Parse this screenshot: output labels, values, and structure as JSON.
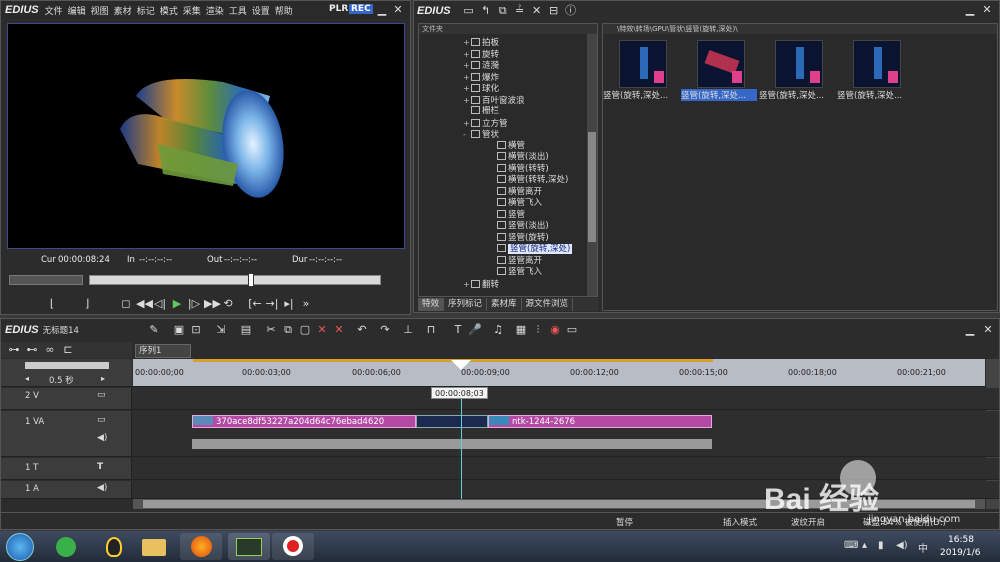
{
  "player": {
    "brand": "EDIUS",
    "menu": [
      "文件",
      "编辑",
      "视图",
      "素材",
      "标记",
      "模式",
      "采集",
      "渲染",
      "工具",
      "设置",
      "帮助"
    ],
    "plr": "PLR",
    "rec": "REC",
    "cur_label": "Cur",
    "cur_value": "00:00:08:24",
    "in_label": "In",
    "in_value": "--:--:--:--",
    "out_label": "Out",
    "out_value": "--:--:--:--",
    "dur_label": "Dur",
    "dur_value": "--:--:--:--"
  },
  "library": {
    "brand": "EDIUS",
    "folder_header": "文件夹",
    "path": "\\特效\\转场\\GPU\\管状\\竖管(旋转,深处)\\",
    "tree": [
      {
        "label": "拍板",
        "level": 1,
        "expand": "+"
      },
      {
        "label": "旋转",
        "level": 1,
        "expand": "+"
      },
      {
        "label": "涟漪",
        "level": 1,
        "expand": "+"
      },
      {
        "label": "爆炸",
        "level": 1,
        "expand": "+"
      },
      {
        "label": "球化",
        "level": 1,
        "expand": "+"
      },
      {
        "label": "百叶窗波浪",
        "level": 1,
        "expand": "+"
      },
      {
        "label": "栅栏",
        "level": 1,
        "expand": ""
      },
      {
        "label": "立方管",
        "level": 1,
        "expand": "+"
      },
      {
        "label": "管状",
        "level": 1,
        "expand": "-"
      },
      {
        "label": "横管",
        "level": 2,
        "expand": ""
      },
      {
        "label": "横管(淡出)",
        "level": 2,
        "expand": ""
      },
      {
        "label": "横管(转转)",
        "level": 2,
        "expand": ""
      },
      {
        "label": "横管(转转,深处)",
        "level": 2,
        "expand": ""
      },
      {
        "label": "横管离开",
        "level": 2,
        "expand": ""
      },
      {
        "label": "横管飞入",
        "level": 2,
        "expand": ""
      },
      {
        "label": "竖管",
        "level": 2,
        "expand": ""
      },
      {
        "label": "竖管(淡出)",
        "level": 2,
        "expand": ""
      },
      {
        "label": "竖管(旋转)",
        "level": 2,
        "expand": ""
      },
      {
        "label": "竖管(旋转,深处)",
        "level": 2,
        "expand": "",
        "selected": true
      },
      {
        "label": "竖管离开",
        "level": 2,
        "expand": ""
      },
      {
        "label": "竖管飞入",
        "level": 2,
        "expand": ""
      },
      {
        "label": "翻转",
        "level": 1,
        "expand": "+"
      }
    ],
    "tabs": [
      "特效",
      "序列标记",
      "素材库",
      "源文件浏览"
    ],
    "thumbs": [
      {
        "label": "竖管(旋转,深处...",
        "selected": false
      },
      {
        "label": "竖管(旋转,深处...",
        "selected": true
      },
      {
        "label": "竖管(旋转,深处...",
        "selected": false
      },
      {
        "label": "竖管(旋转,深处...",
        "selected": false
      }
    ]
  },
  "timeline": {
    "brand": "EDIUS",
    "project": "无标题14",
    "sequence_tab": "序列1",
    "zoom": "0.5 秒",
    "ruler": [
      "00:00:00;00",
      "00:00:03;00",
      "00:00:06;00",
      "00:00:09;00",
      "00:00:12;00",
      "00:00:15;00",
      "00:00:18;00",
      "00:00:21;00"
    ],
    "playhead_tip": "00:00:08;03",
    "tracks": [
      {
        "label": "2 V"
      },
      {
        "label": "1 VA"
      },
      {
        "label": "1 T"
      },
      {
        "label": "1 A"
      }
    ],
    "clip1": "370ace8df53227a204d64c76ebad4620",
    "clip2": "ntk-1244-2676"
  },
  "status": {
    "pause": "暂停",
    "insert": "插入模式",
    "ripple": "波纹开启",
    "disk": "磁盘:54% 被使用(D:)"
  },
  "tray": {
    "time": "16:58",
    "date": "2019/1/6",
    "input": "中"
  },
  "watermark": {
    "text": "Bai 经验",
    "sub": "jingyan.baidu.com"
  }
}
